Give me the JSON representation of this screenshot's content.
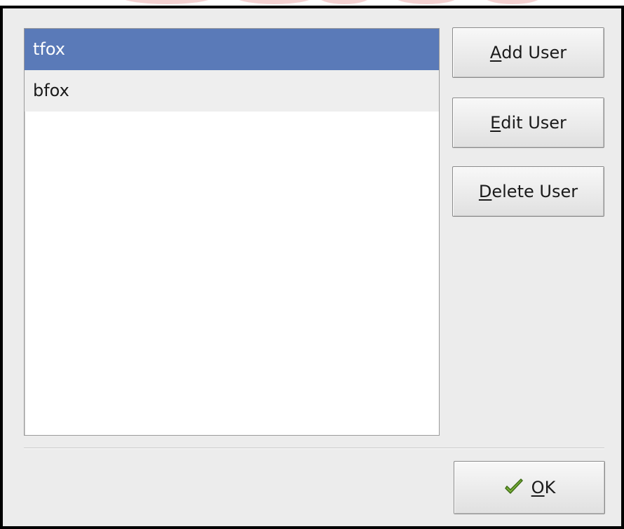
{
  "user_list": {
    "items": [
      {
        "name": "tfox",
        "selected": true
      },
      {
        "name": "bfox",
        "selected": false
      }
    ]
  },
  "buttons": {
    "add_user": {
      "mnemonic": "A",
      "rest": "dd User"
    },
    "edit_user": {
      "mnemonic": "E",
      "rest": "dit User"
    },
    "delete_user": {
      "mnemonic": "D",
      "rest": "elete User"
    },
    "ok": {
      "mnemonic": "O",
      "rest": "K",
      "icon": "checkmark-icon"
    }
  },
  "colors": {
    "selection": "#5a7ab8",
    "dialog_bg": "#ececec",
    "checkmark": "#7ab03a"
  }
}
